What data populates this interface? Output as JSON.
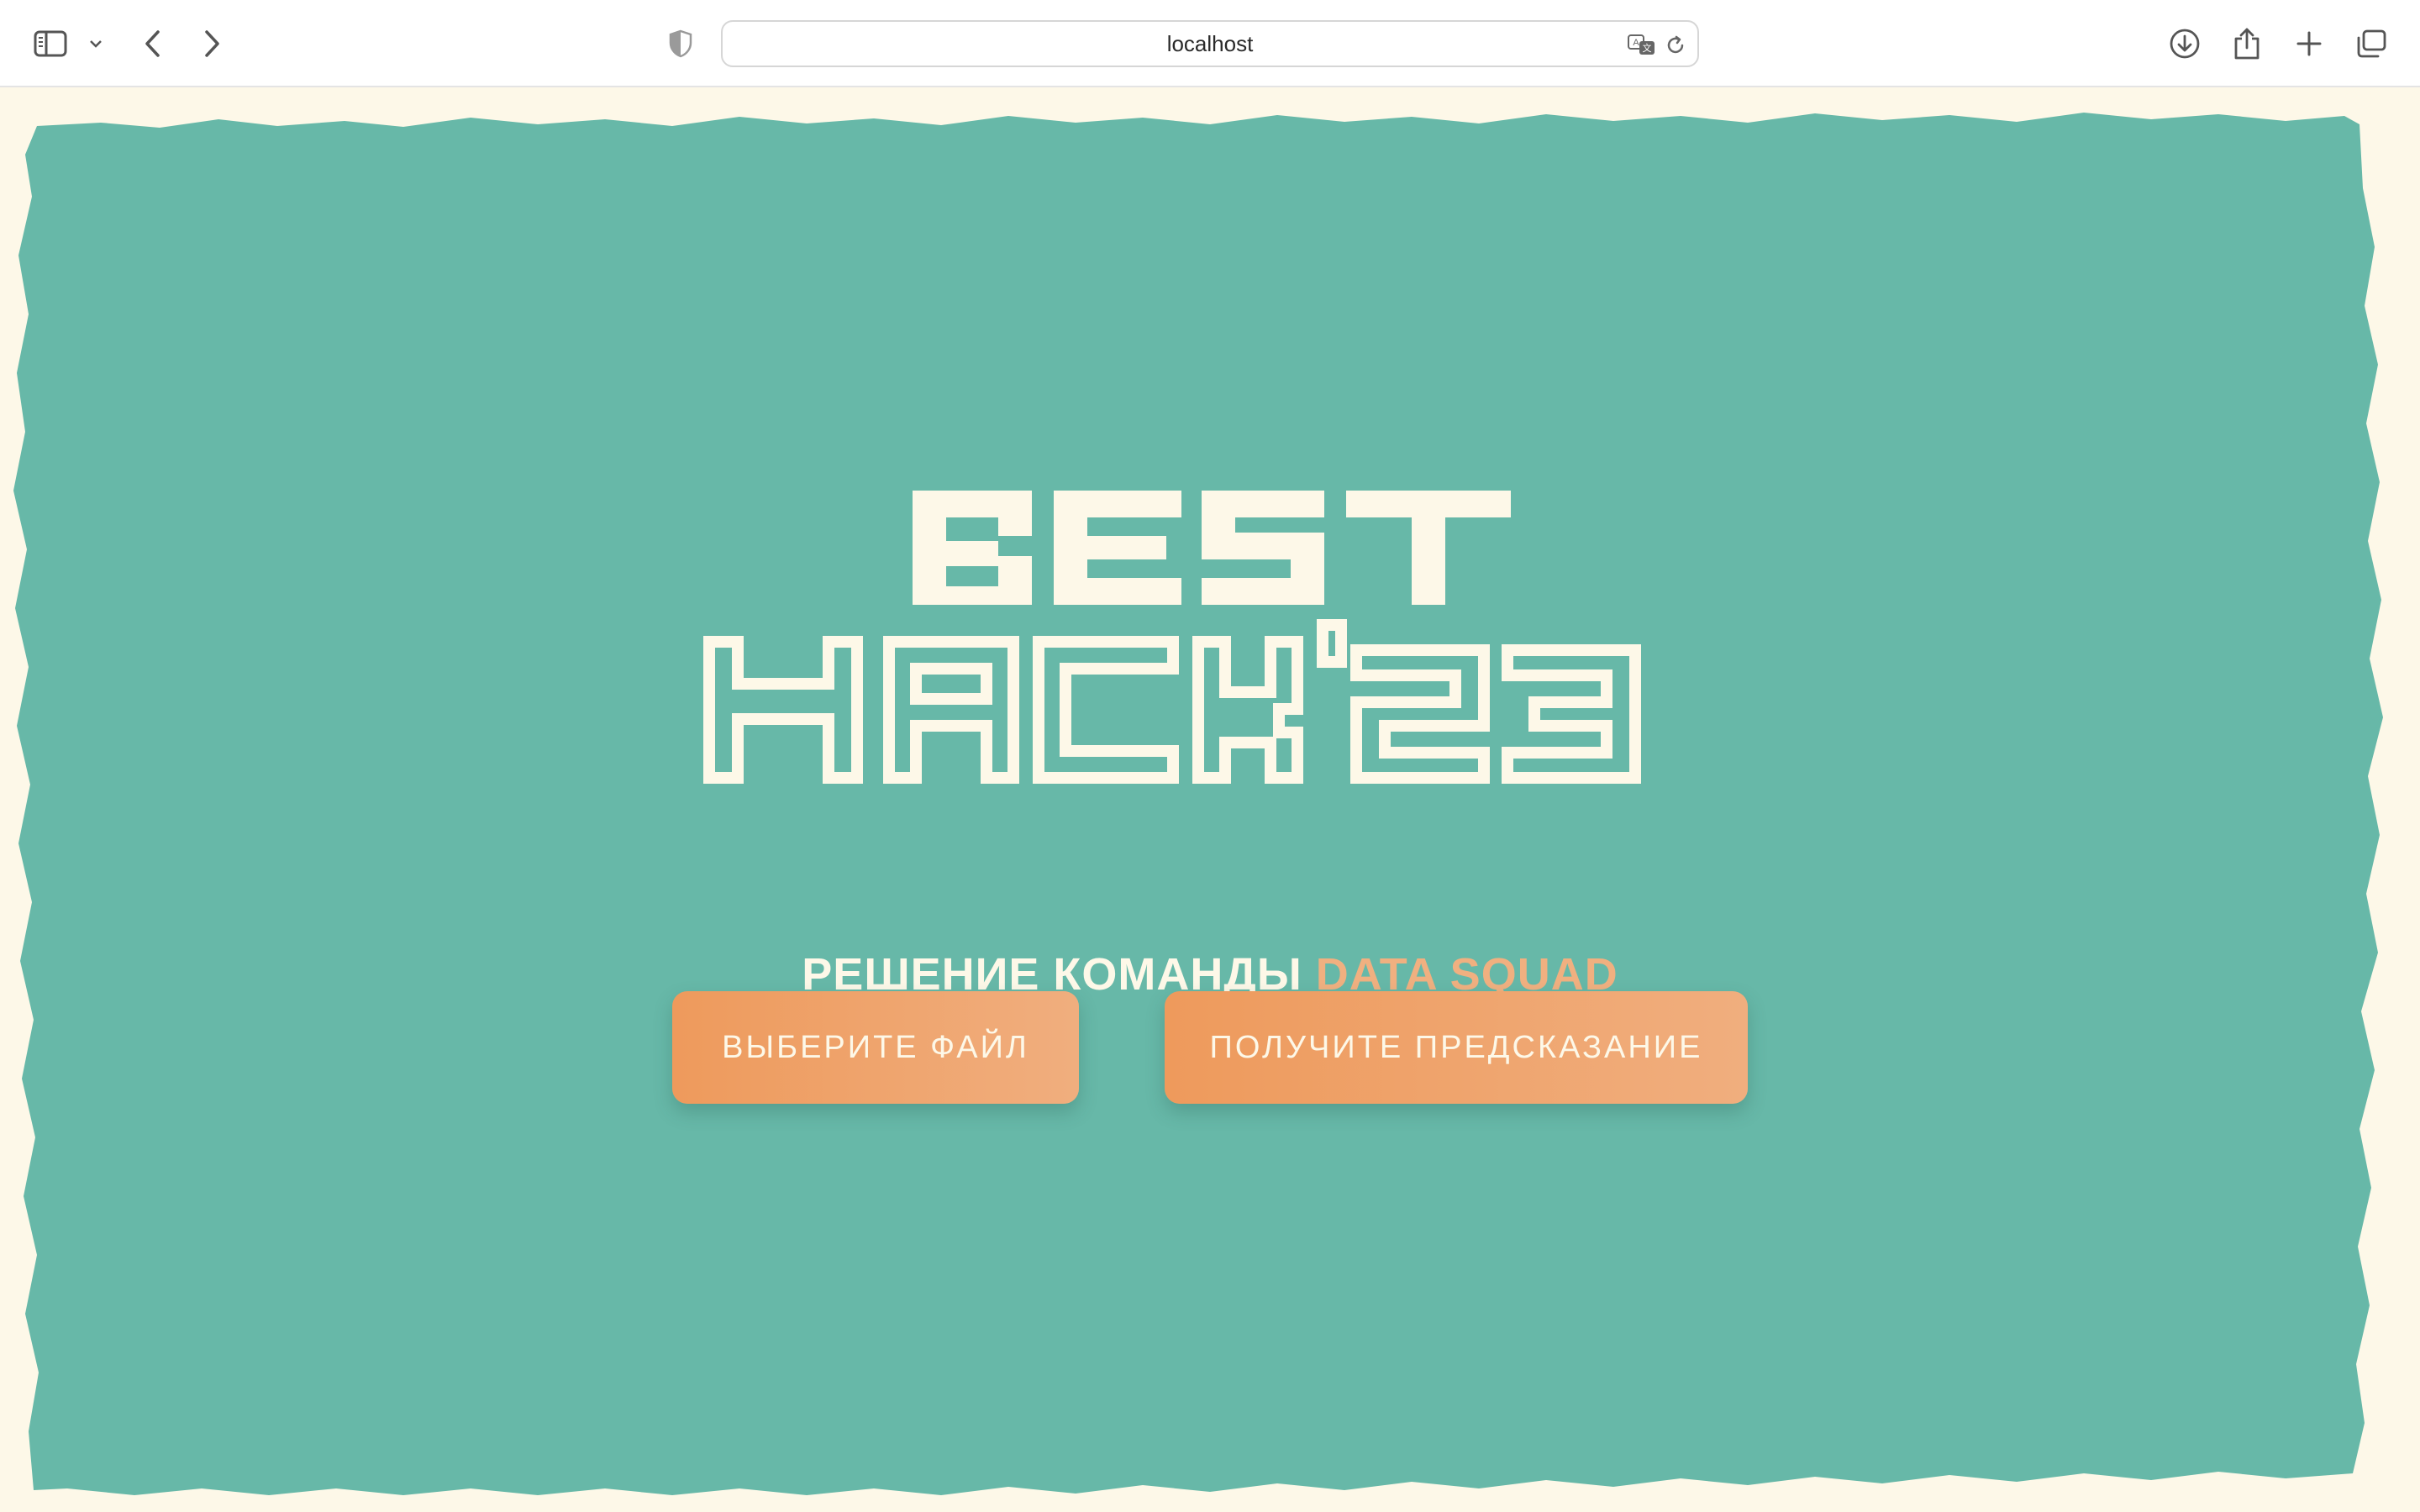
{
  "browser": {
    "address": "localhost",
    "icons": {
      "sidebar": "sidebar-icon",
      "sidebar_menu": "chevron-down-icon",
      "back": "back-arrow-icon",
      "forward": "forward-arrow-icon",
      "privacy": "shield-icon",
      "translate": "translate-icon",
      "reload": "reload-icon",
      "download": "download-icon",
      "share": "share-icon",
      "new_tab": "plus-icon",
      "tabs": "tab-overview-icon"
    }
  },
  "page": {
    "logo": {
      "line1": "BEST",
      "line2": "HACK'23"
    },
    "subtitle_prefix": "РЕШЕНИЕ КОМАНДЫ ",
    "subtitle_accent": "DATA SQUAD",
    "buttons": {
      "choose_file": "ВЫБЕРИТЕ ФАЙЛ",
      "get_prediction": "ПОЛУЧИТЕ ПРЕДСКАЗАНИЕ"
    },
    "colors": {
      "background": "#fdf8e8",
      "panel": "#67b8a8",
      "accent": "#f0b080",
      "button": "#ee9a5c"
    }
  }
}
